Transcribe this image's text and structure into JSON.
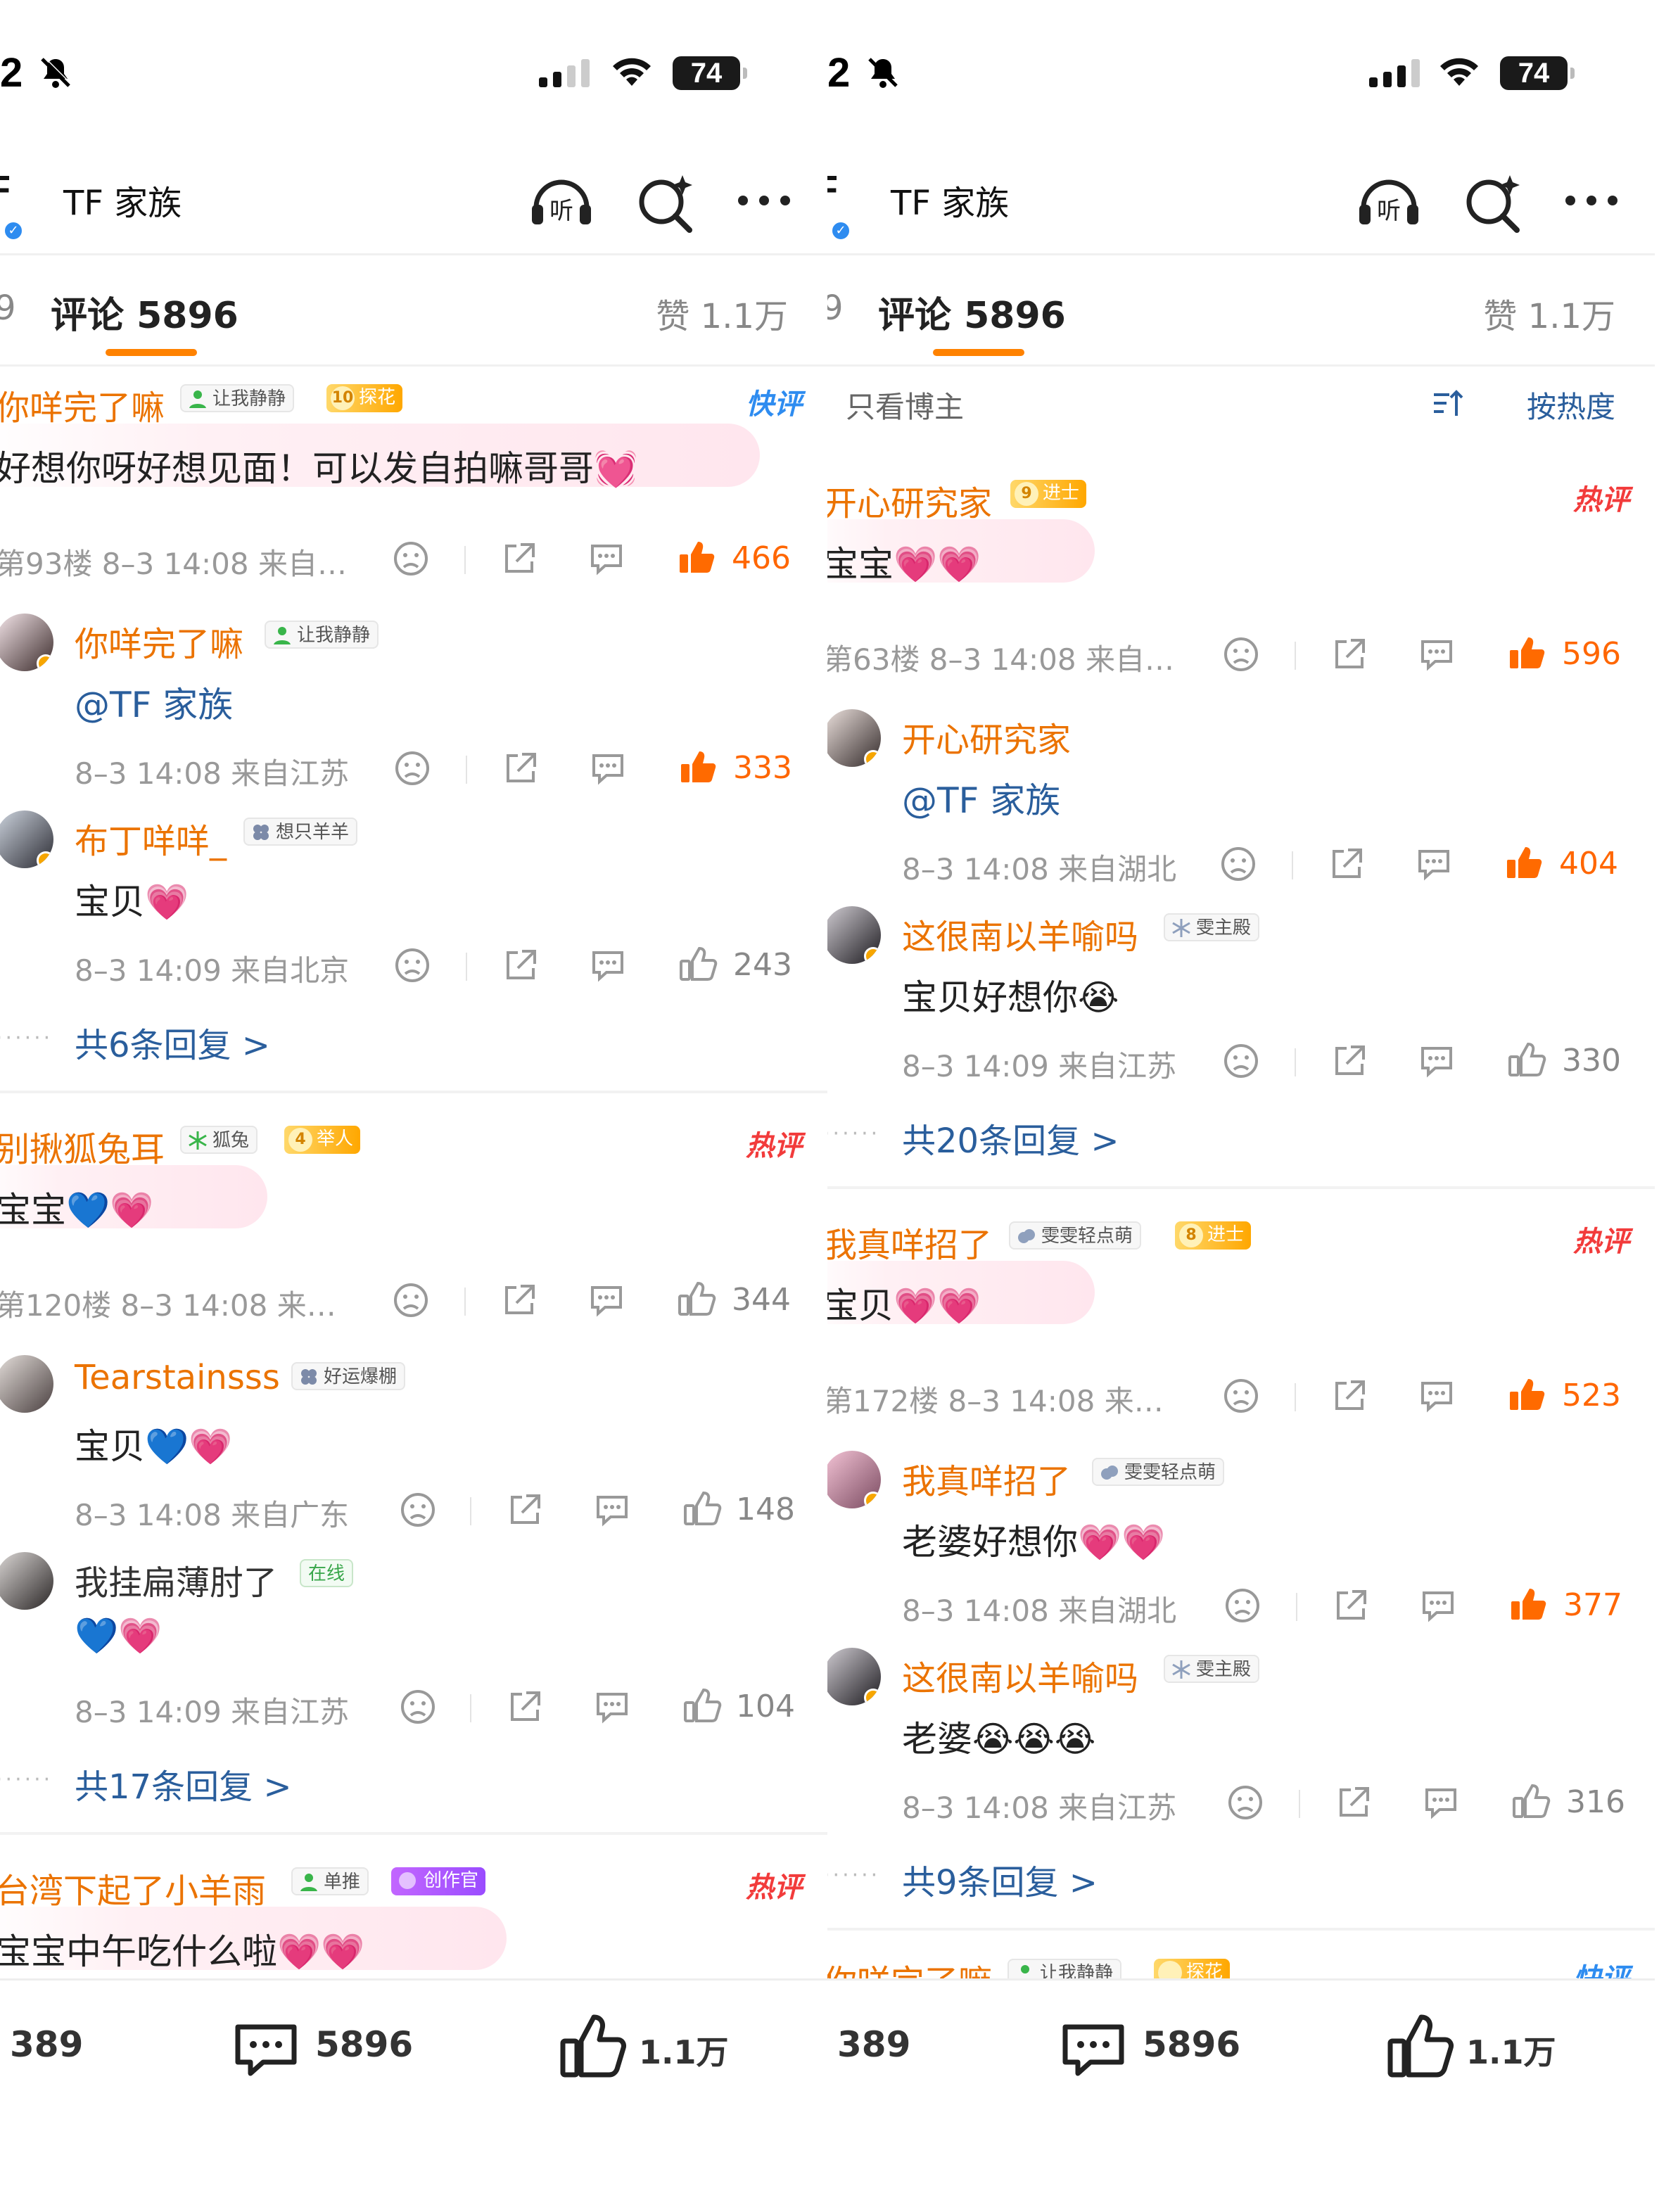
{
  "status_bar": {
    "time": "2",
    "battery": "74"
  },
  "header": {
    "account_name": "TF 家族",
    "logo_text": "F"
  },
  "tabs": {
    "comments_label": "评论 5896",
    "likes_label": "赞 1.1万",
    "left_cut": "9"
  },
  "filter": {
    "only_blogger": "只看博主",
    "sort_label": "按热度"
  },
  "left": {
    "c1": {
      "user": "你咩完了嘛",
      "badge": "让我静静",
      "level": "10",
      "level_label": "探花",
      "tag": "快评",
      "text": "好想你呀好想见面！可以发自拍嘛哥哥💓",
      "meta": "第93楼 8–3 14:08 来自…",
      "likes": "466",
      "replies": [
        {
          "user": "你咩完了嘛",
          "badge": "让我静静",
          "text": "@TF 家族",
          "meta": "8–3 14:08 来自江苏",
          "likes": "333"
        },
        {
          "user": "布丁咩咩_",
          "badge": "想只羊羊",
          "text": "宝贝💗",
          "meta": "8–3 14:09 来自北京",
          "likes": "243"
        }
      ],
      "more": "共6条回复 >"
    },
    "c2": {
      "user": "别揪狐兔耳",
      "badge": "狐兔",
      "level": "4",
      "level_label": "举人",
      "tag": "热评",
      "text": "宝宝💙💗",
      "meta": "第120楼 8–3 14:08 来…",
      "likes": "344",
      "replies": [
        {
          "user": "Tearstainsss",
          "badge": "好运爆棚",
          "text": "宝贝💙💗",
          "meta": "8–3 14:08 来自广东",
          "likes": "148"
        },
        {
          "user": "我挂扁薄肘了",
          "badge": "在线",
          "text": "💙💗",
          "meta": "8–3 14:09 来自江苏",
          "likes": "104"
        }
      ],
      "more": "共17条回复 >"
    },
    "c3": {
      "user": "台湾下起了小羊雨",
      "badge": "单推",
      "badge2": "创作官",
      "tag": "热评",
      "text": "宝宝中午吃什么啦💗💗"
    }
  },
  "right": {
    "c1": {
      "user": "开心研究家",
      "level": "9",
      "level_label": "进士",
      "tag": "热评",
      "text": "宝宝💗💗",
      "meta": "第63楼 8–3 14:08 来自…",
      "likes": "596",
      "replies": [
        {
          "user": "开心研究家",
          "text": "@TF 家族",
          "meta": "8–3 14:08 来自湖北",
          "likes": "404"
        },
        {
          "user": "这很南以羊喻吗",
          "badge": "雯主殿",
          "text": "宝贝好想你😭",
          "meta": "8–3 14:09 来自江苏",
          "likes": "330"
        }
      ],
      "more": "共20条回复 >"
    },
    "c2": {
      "user": "我真咩招了",
      "badge": "雯雯轻点萌",
      "level": "8",
      "level_label": "进士",
      "tag": "热评",
      "text": "宝贝💗💗",
      "meta": "第172楼 8–3 14:08 来…",
      "likes": "523",
      "replies": [
        {
          "user": "我真咩招了",
          "badge": "雯雯轻点萌",
          "text": "老婆好想你💗💗",
          "meta": "8–3 14:08 来自湖北",
          "likes": "377"
        },
        {
          "user": "这很南以羊喻吗",
          "badge": "雯主殿",
          "text": "老婆😭😭😭",
          "meta": "8–3 14:08 来自江苏",
          "likes": "316"
        }
      ],
      "more": "共9条回复 >"
    },
    "c3": {
      "user": "你咩完了嘛",
      "badge": "让我静静",
      "level_label": "探花",
      "tag": "快评"
    }
  },
  "bottom_bar": {
    "reposts": "389",
    "comments": "5896",
    "likes": "1.1万"
  },
  "colors": {
    "accent": "#ff8200",
    "username": "#eb7300",
    "link": "#2a5e9c",
    "hot": "#f23b3b"
  }
}
